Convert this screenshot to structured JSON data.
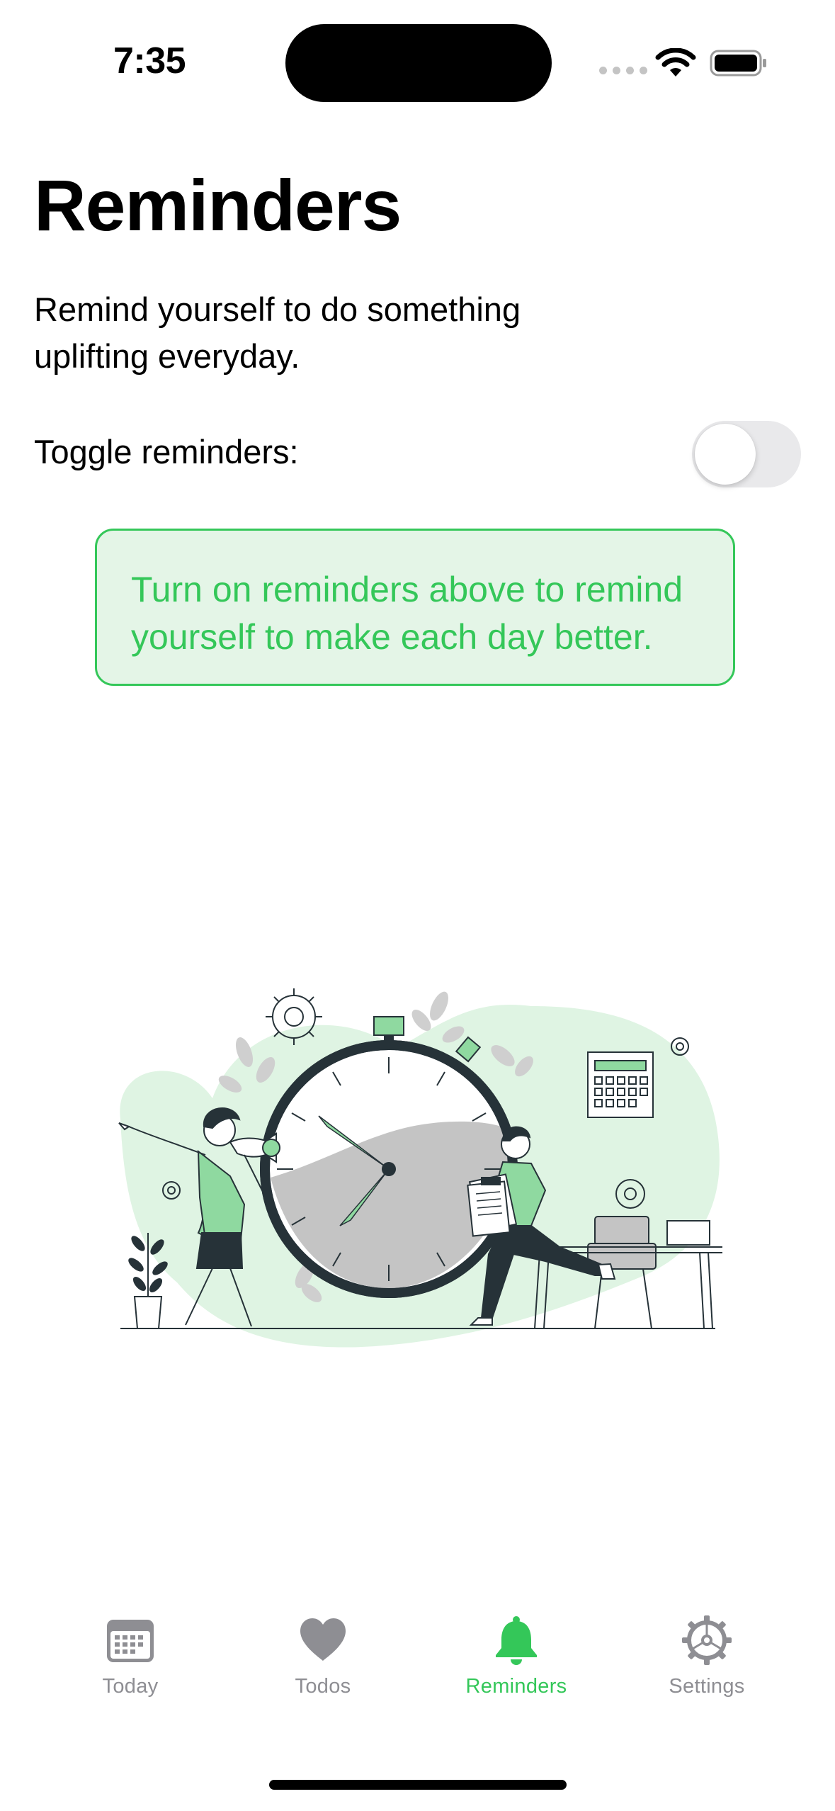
{
  "status_bar": {
    "time": "7:35"
  },
  "page": {
    "title": "Reminders",
    "description": "Remind yourself to do something uplifting everyday.",
    "toggle_label": "Toggle reminders:",
    "toggle_on": false,
    "info_message": "Turn on reminders above to remind yourself to make each day better."
  },
  "tabs": [
    {
      "label": "Today",
      "icon": "calendar-icon",
      "active": false
    },
    {
      "label": "Todos",
      "icon": "heart-icon",
      "active": false
    },
    {
      "label": "Reminders",
      "icon": "bell-icon",
      "active": true
    },
    {
      "label": "Settings",
      "icon": "gear-icon",
      "active": false
    }
  ],
  "colors": {
    "accent": "#34c759",
    "info_bg": "#e4f5e7",
    "tab_inactive": "#8e8e93",
    "toggle_off": "#e9e9eb",
    "illustration_green": "#8fd9a0",
    "illustration_dark": "#263238"
  }
}
